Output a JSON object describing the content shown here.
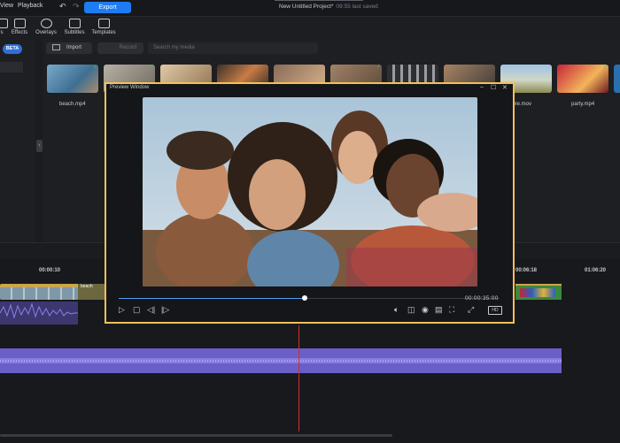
{
  "menubar": {
    "items": [
      "View",
      "Playback"
    ],
    "export_label": "Export",
    "project_title": "New Untitled Project*",
    "saved_status": "09:55 last saved"
  },
  "toolbar": {
    "tools": [
      "Effects",
      "Overlays",
      "Subtitles",
      "Templates"
    ]
  },
  "left": {
    "beta_label": "BETA"
  },
  "media": {
    "import_label": "Import",
    "record_label": "Record",
    "search_placeholder": "Search my media",
    "labels": [
      "beach.mp4",
      "nature.mov",
      "party.mp4"
    ]
  },
  "preview": {
    "title": "Preview Window",
    "timecode": "00:00:35:00",
    "quality": "HD",
    "progress": 0.49
  },
  "timeline": {
    "timecodes": [
      "00:00:10",
      "00:06:18",
      "01:06:20"
    ],
    "clip_label": "beach"
  },
  "colors": {
    "accent": "#1e7cf2",
    "preview_border": "#f5c05a",
    "playhead": "#d62d2d",
    "audio": "#6a5ec9"
  }
}
